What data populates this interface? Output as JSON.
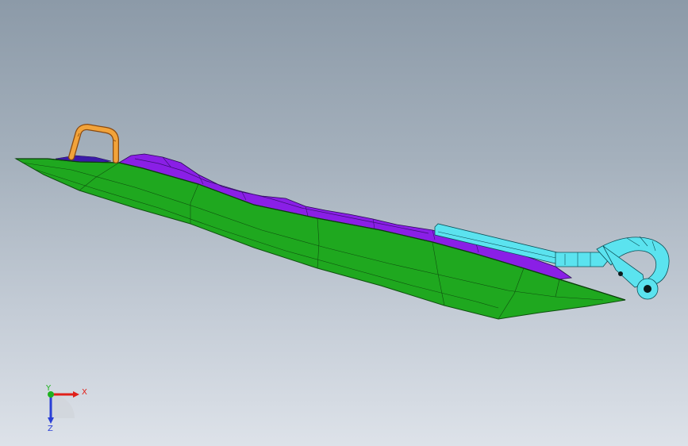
{
  "viewport": {
    "background_top": "#8c9aa8",
    "background_bottom": "#dde2e9"
  },
  "model": {
    "hull_color": "#1fa81f",
    "deck_color": "#8a1fe6",
    "handle_color": "#f2a33a",
    "tow_arm_color": "#5be3ef"
  },
  "triad": {
    "x_label": "X",
    "y_label": "Y",
    "z_label": "Z",
    "x_color": "#e0201a",
    "y_color": "#1fb21f",
    "z_color": "#2a3fd6"
  }
}
